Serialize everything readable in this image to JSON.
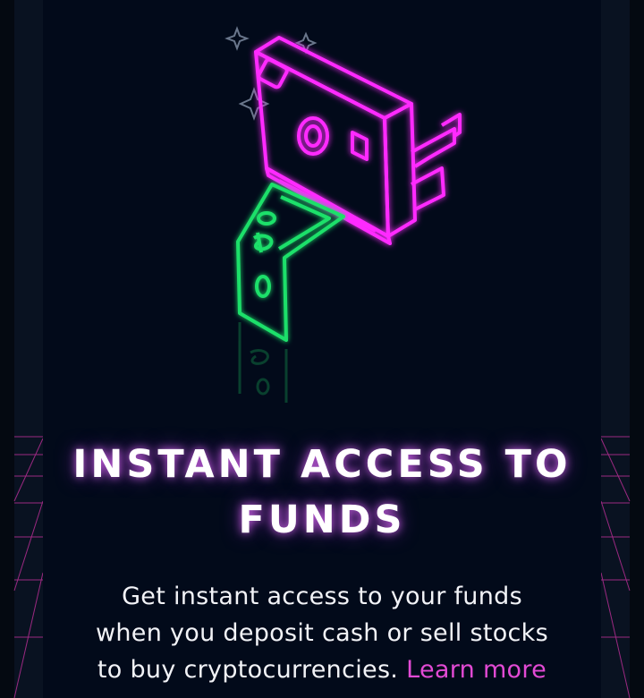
{
  "hero": {
    "illustration_icon": "neon-instant-camera-printing-dollar-bill-icon",
    "title_line1": "INSTANT ACCESS TO",
    "title_line2": "FUNDS",
    "body_line1": "Get instant access to your funds",
    "body_line2": "when you deposit cash or sell stocks",
    "body_line3_prefix": "to buy cryptocurrencies.",
    "learn_more_label": "Learn more"
  },
  "colors": {
    "background": "#020a1a",
    "neon_magenta": "#ff2cff",
    "neon_green": "#1fe06a",
    "link": "#e24ad4",
    "text": "#ffffff"
  }
}
